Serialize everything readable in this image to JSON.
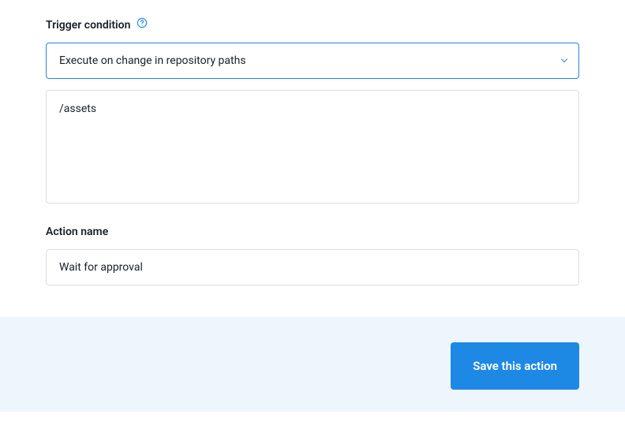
{
  "trigger": {
    "label": "Trigger condition",
    "select_value": "Execute on change in repository paths",
    "paths_value": "/assets"
  },
  "action_name": {
    "label": "Action name",
    "value": "Wait for approval"
  },
  "footer": {
    "save_label": "Save this action"
  }
}
